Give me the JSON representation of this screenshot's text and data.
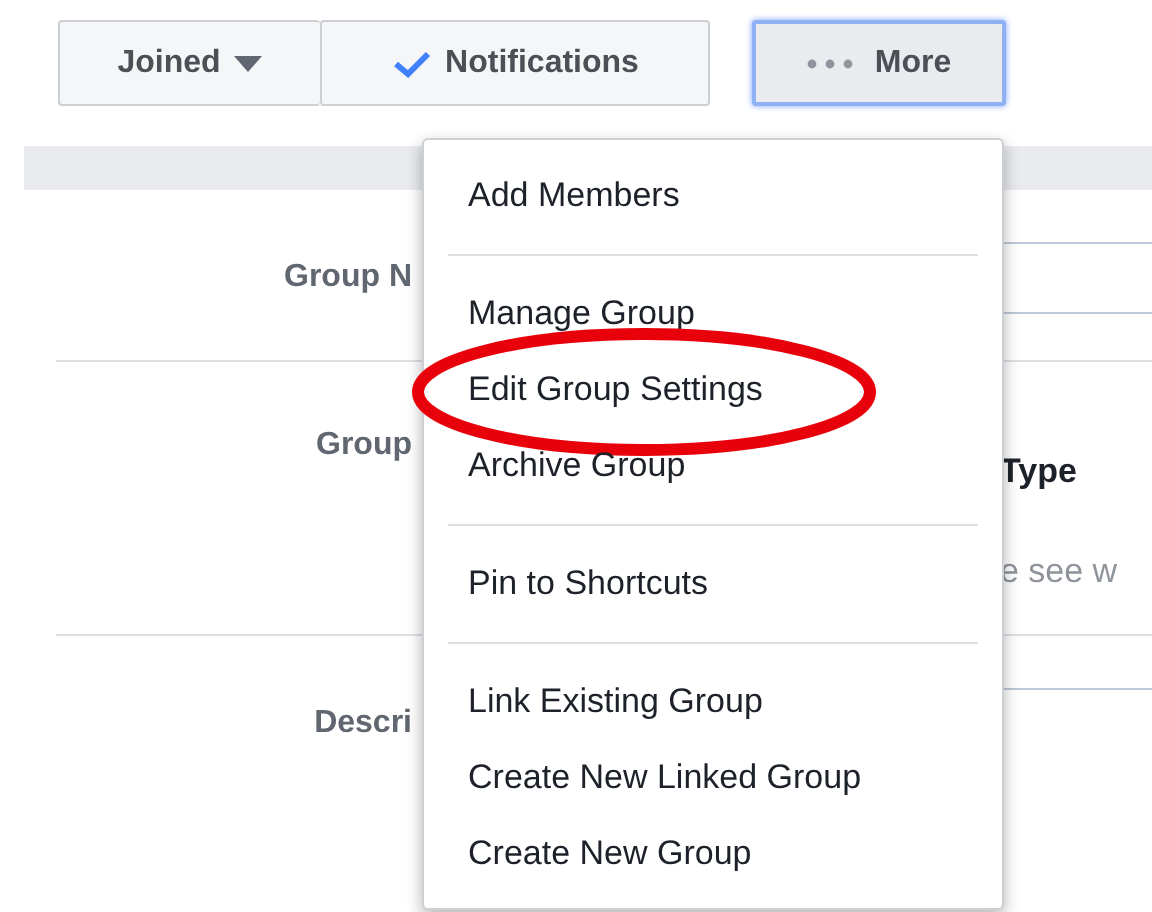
{
  "buttons": [
    {
      "label": "Joined",
      "kind": "dropdown"
    },
    {
      "label": "Notifications",
      "kind": "check"
    }
  ],
  "more_button": {
    "label": "More",
    "selected": true
  },
  "form": {
    "rows": [
      {
        "label": "Group N",
        "kind": "field"
      },
      {
        "label": "Group",
        "kind": "text",
        "heading": "Type",
        "hint": "e see w"
      },
      {
        "label": "Descri",
        "kind": "field"
      }
    ]
  },
  "menu": {
    "sections": [
      [
        {
          "label": "Add Members",
          "highlighted": false
        }
      ],
      [
        {
          "label": "Manage Group",
          "highlighted": false
        },
        {
          "label": "Edit Group Settings",
          "highlighted": true
        },
        {
          "label": "Archive Group",
          "highlighted": false
        }
      ],
      [
        {
          "label": "Pin to Shortcuts",
          "highlighted": false
        }
      ],
      [
        {
          "label": "Link Existing Group",
          "highlighted": false
        },
        {
          "label": "Create New Linked Group",
          "highlighted": false
        },
        {
          "label": "Create New Group",
          "highlighted": false
        }
      ]
    ]
  }
}
